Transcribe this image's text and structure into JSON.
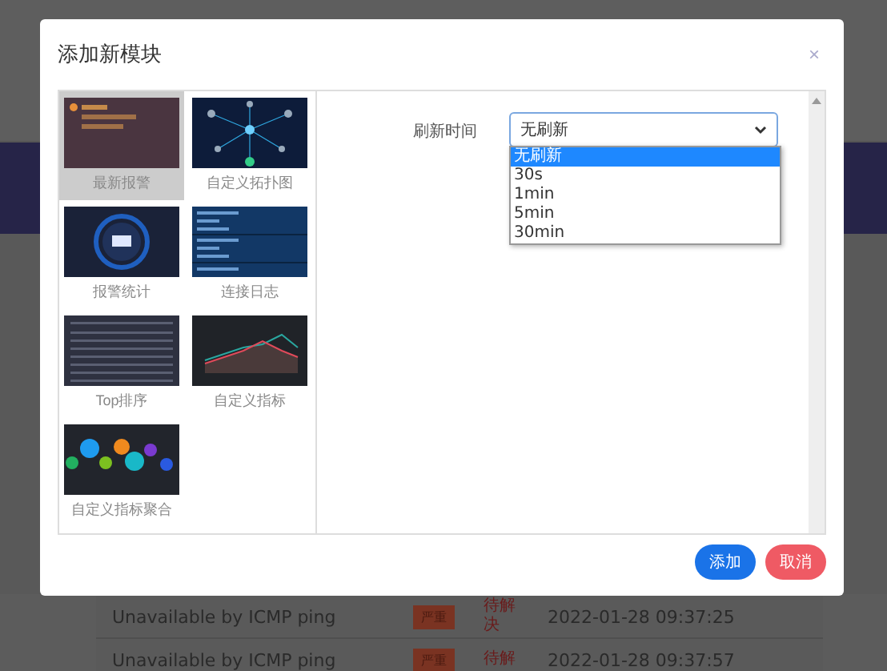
{
  "dialog": {
    "title": "添加新模块",
    "close": "×",
    "modules": [
      {
        "label": "最新报警",
        "kind": "alarm",
        "selected": true
      },
      {
        "label": "自定义拓扑图",
        "kind": "topology",
        "selected": false
      },
      {
        "label": "报警统计",
        "kind": "gauge",
        "selected": false
      },
      {
        "label": "连接日志",
        "kind": "log",
        "selected": false
      },
      {
        "label": "Top排序",
        "kind": "table",
        "selected": false
      },
      {
        "label": "自定义指标",
        "kind": "line",
        "selected": false
      },
      {
        "label": "自定义指标聚合",
        "kind": "bubbles",
        "selected": false
      }
    ],
    "refresh": {
      "label": "刷新时间",
      "value": "无刷新",
      "options": [
        {
          "label": "无刷新",
          "selected": true
        },
        {
          "label": "30s",
          "selected": false
        },
        {
          "label": "1min",
          "selected": false
        },
        {
          "label": "5min",
          "selected": false
        },
        {
          "label": "30min",
          "selected": false
        }
      ]
    },
    "buttons": [
      {
        "label": "添加",
        "kind": "primary"
      },
      {
        "label": "取消",
        "kind": "danger"
      }
    ]
  },
  "background_rows": [
    {
      "message": "Unavailable by ICMP ping",
      "severity": "严重",
      "status": "待解决",
      "time": "2022-01-28 09:37:25"
    },
    {
      "message": "Unavailable by ICMP ping",
      "severity": "严重",
      "status": "待解",
      "time": "2022-01-28 09:37:57"
    }
  ]
}
